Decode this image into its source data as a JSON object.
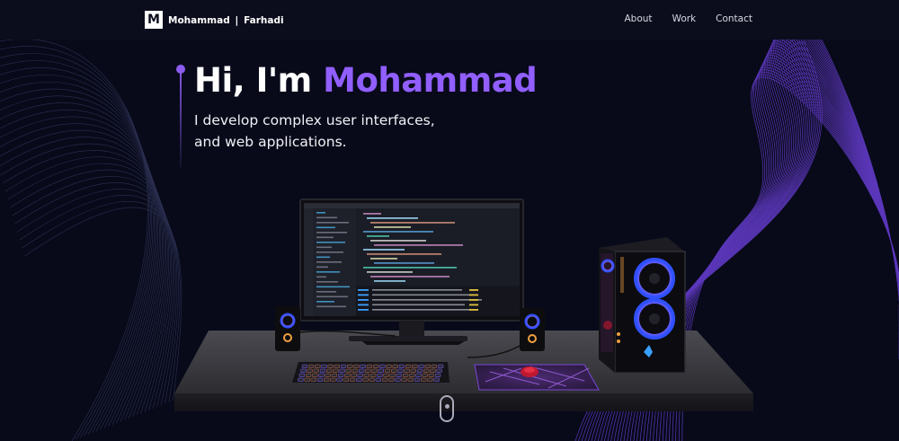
{
  "brand": {
    "logo_letter": "M",
    "first_name": "Mohammad",
    "separator": "|",
    "last_name": "Farhadi"
  },
  "nav": {
    "items": [
      {
        "label": "About"
      },
      {
        "label": "Work"
      },
      {
        "label": "Contact"
      }
    ]
  },
  "hero": {
    "greeting": "Hi, I'm ",
    "name": "Mohammad",
    "subtitle": "I develop complex user interfaces, and web applications."
  },
  "colors": {
    "background": "#080a1a",
    "navbar": "#0b0d1c",
    "accent": "#915eff",
    "text": "#ffffff"
  },
  "icons": {
    "brand": "m-logo-icon",
    "scroll": "mouse-scroll-icon"
  }
}
